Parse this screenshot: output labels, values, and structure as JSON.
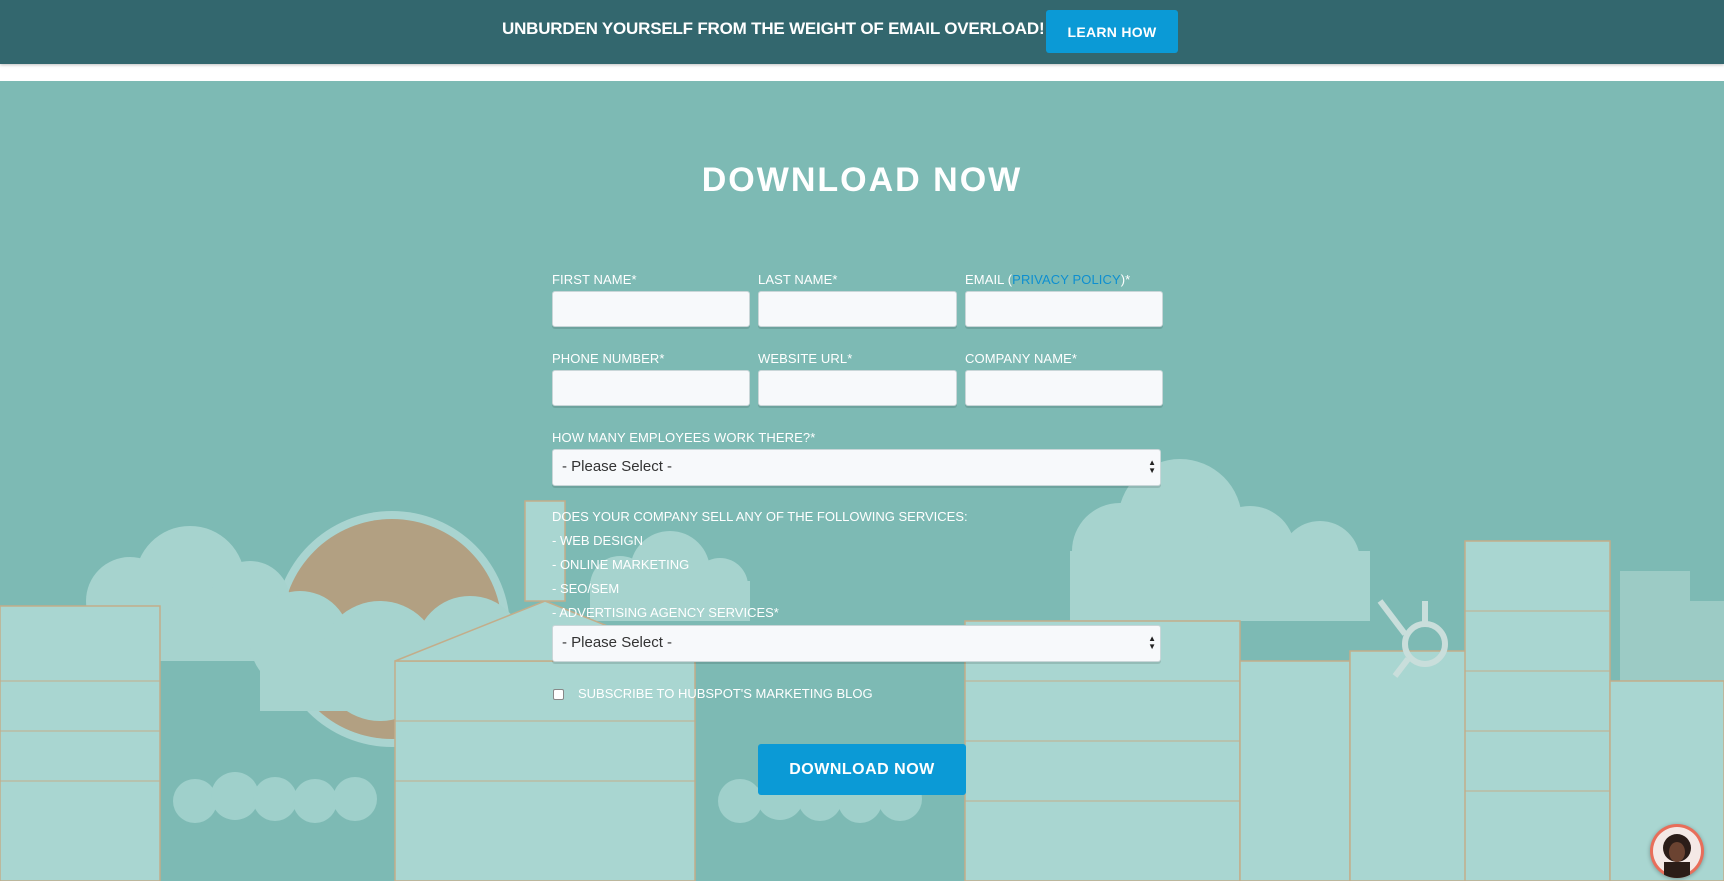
{
  "banner": {
    "text": "UNBURDEN YOURSELF FROM THE WEIGHT OF EMAIL OVERLOAD!",
    "button_label": "LEARN HOW"
  },
  "form": {
    "title": "DOWNLOAD NOW",
    "first_name_label": "FIRST NAME*",
    "last_name_label": "LAST NAME*",
    "email_label_prefix": "EMAIL (",
    "privacy_link": "PRIVACY POLICY",
    "email_label_suffix": ")*",
    "phone_label": "PHONE NUMBER*",
    "website_label": "WEBSITE URL*",
    "company_label": "COMPANY NAME*",
    "employees_label": "HOW MANY EMPLOYEES WORK THERE?*",
    "employees_value": "- Please Select -",
    "services_lines": [
      "DOES YOUR COMPANY SELL ANY OF THE FOLLOWING SERVICES:",
      "- WEB DESIGN",
      "- ONLINE MARKETING",
      "- SEO/SEM",
      "- ADVERTISING AGENCY SERVICES*"
    ],
    "services_value": "- Please Select -",
    "subscribe_label": "SUBSCRIBE TO HUBSPOT'S MARKETING BLOG",
    "submit_label": "DOWNLOAD NOW"
  },
  "colors": {
    "banner_bg": "#33676e",
    "hero_bg": "#7dbab4",
    "accent_button": "#0b9ad6",
    "link": "#0e8fd0"
  },
  "icons": {
    "chat": "chat-avatar-icon",
    "sprocket": "hubspot-sprocket-icon"
  }
}
